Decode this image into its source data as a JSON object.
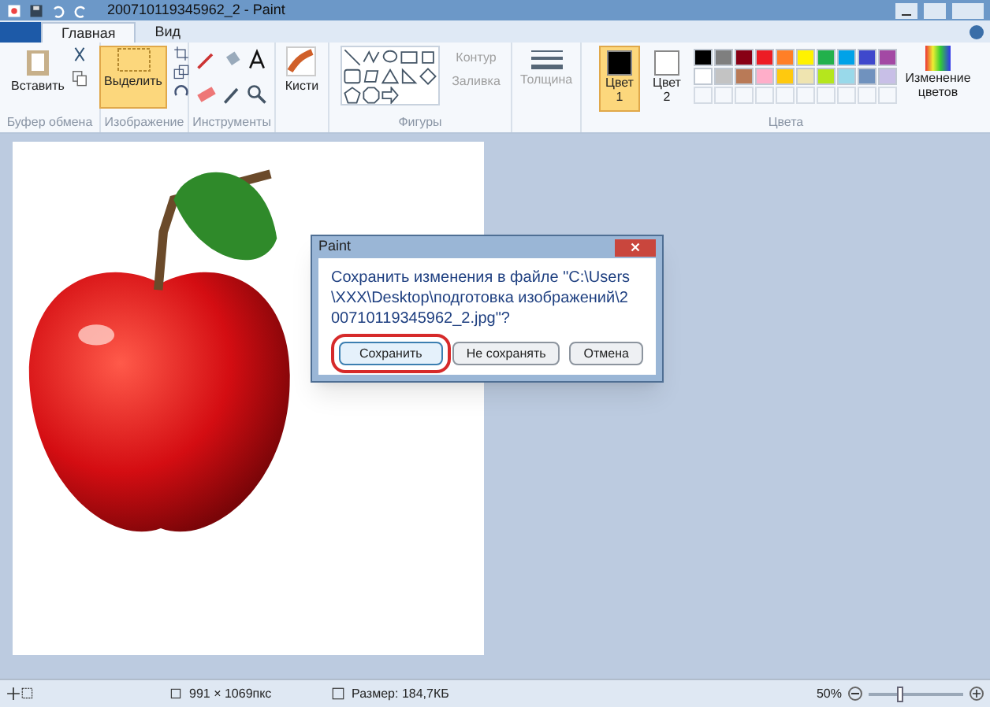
{
  "window": {
    "title": "200710119345962_2 - Paint"
  },
  "tabs": [
    {
      "label": "Главная",
      "selected": true
    },
    {
      "label": "Вид",
      "selected": false
    }
  ],
  "ribbon": {
    "clipboard": {
      "paste": "Вставить",
      "group": "Буфер обмена"
    },
    "image": {
      "select": "Выделить",
      "selected": true,
      "group": "Изображение"
    },
    "tools": {
      "group": "Инструменты"
    },
    "brushes": {
      "label": "Кисти"
    },
    "shapes": {
      "outline": {
        "label": "Контур",
        "disabled": true
      },
      "fill": {
        "label": "Заливка",
        "disabled": true
      },
      "group": "Фигуры"
    },
    "size": {
      "label": "Толщина",
      "disabled": true
    },
    "colors": {
      "color1": {
        "label": "Цвет",
        "num": "1",
        "selected": true
      },
      "color2": {
        "label": "Цвет",
        "num": "2",
        "selected": false
      },
      "palette": [
        {
          "color": "#000000"
        },
        {
          "color": "#7f7f7f"
        },
        {
          "color": "#880015"
        },
        {
          "color": "#ed1c24"
        },
        {
          "color": "#ff7f27"
        },
        {
          "color": "#fff200"
        },
        {
          "color": "#22b14c"
        },
        {
          "color": "#00a2e8"
        },
        {
          "color": "#3f48cc"
        },
        {
          "color": "#a349a4"
        },
        {
          "color": "#ffffff"
        },
        {
          "color": "#c3c3c3"
        },
        {
          "color": "#b97a57"
        },
        {
          "color": "#ffaec9"
        },
        {
          "color": "#ffc90e"
        },
        {
          "color": "#efe4b0"
        },
        {
          "color": "#b5e61d"
        },
        {
          "color": "#99d9ea"
        },
        {
          "color": "#7092be"
        },
        {
          "color": "#c8bfe7"
        }
      ],
      "edit": "Изменение цветов",
      "group": "Цвета"
    }
  },
  "dialog": {
    "title": "Paint",
    "message": "Сохранить изменения в файле \"C:\\Users\\XXX\\Desktop\\подготовка изображений\\200710119345962_2.jpg\"?",
    "buttons": [
      {
        "label": "Сохранить",
        "highlighted": true
      },
      {
        "label": "Не сохранять",
        "highlighted": false
      },
      {
        "label": "Отмена",
        "highlighted": false
      }
    ]
  },
  "status_bar": {
    "dimensions": "991 × 1069пкс",
    "size": "Размер: 184,7КБ",
    "zoom": "50%",
    "zoom_slider": {
      "level": 0.3
    }
  }
}
